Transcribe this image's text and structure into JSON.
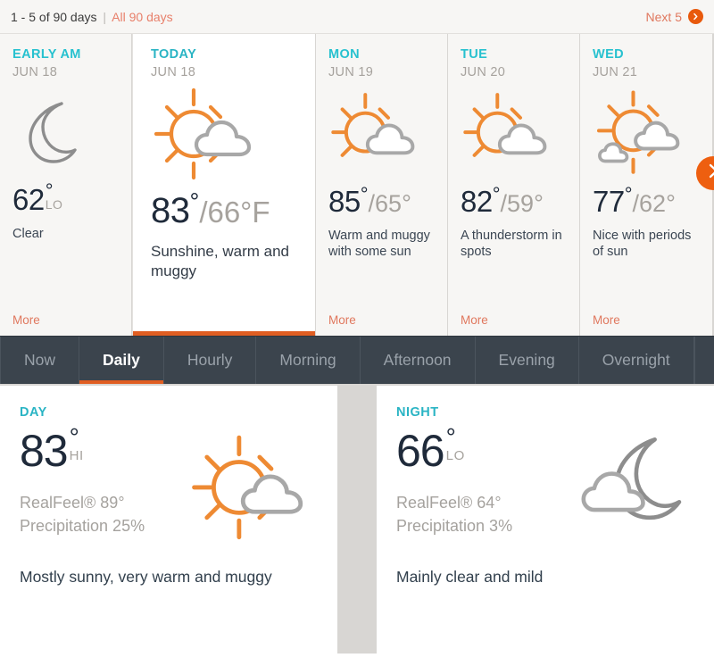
{
  "pager": {
    "range_text": "1 - 5 of 90 days",
    "separator": "|",
    "all_days_label": "All 90 days",
    "next_label": "Next 5",
    "next_icon": "arrow-right-circle-icon"
  },
  "colors": {
    "accent_orange": "#e05e22",
    "link_orange": "#e0785e",
    "teal": "#2ab4c4",
    "dark_text": "#1f2a3a",
    "muted": "#a6a29d",
    "tabbar_bg": "#3b444d",
    "strip_bg": "#d8d6d3"
  },
  "forecast_cards": [
    {
      "day": "EARLY AM",
      "date": "JUN 18",
      "icon": "moon-icon",
      "temp_main": "62",
      "degree": "°",
      "temp_label": "LO",
      "temp_secondary": "",
      "phrase": "Clear",
      "more_label": "More",
      "active": false
    },
    {
      "day": "TODAY",
      "date": "JUN 18",
      "icon": "sun-cloud-icon",
      "temp_main": "83",
      "degree": "°",
      "temp_label": "",
      "temp_secondary": "/66°F",
      "phrase": "Sunshine, warm and muggy",
      "more_label": "",
      "active": true
    },
    {
      "day": "MON",
      "date": "JUN 19",
      "icon": "sun-cloud-icon",
      "temp_main": "85",
      "degree": "°",
      "temp_label": "",
      "temp_secondary": "/65°",
      "phrase": "Warm and muggy with some sun",
      "more_label": "More",
      "active": false
    },
    {
      "day": "TUE",
      "date": "JUN 20",
      "icon": "sun-cloud-icon",
      "temp_main": "82",
      "degree": "°",
      "temp_label": "",
      "temp_secondary": "/59°",
      "phrase": "A thunderstorm in spots",
      "more_label": "More",
      "active": false
    },
    {
      "day": "WED",
      "date": "JUN 21",
      "icon": "sun-two-clouds-icon",
      "temp_main": "77",
      "degree": "°",
      "temp_label": "",
      "temp_secondary": "/62°",
      "phrase": "Nice with periods of sun",
      "more_label": "More",
      "active": false
    }
  ],
  "next_button": {
    "icon": "chevron-right-icon"
  },
  "tabs": [
    {
      "label": "Now",
      "active": false
    },
    {
      "label": "Daily",
      "active": true
    },
    {
      "label": "Hourly",
      "active": false
    },
    {
      "label": "Morning",
      "active": false
    },
    {
      "label": "Afternoon",
      "active": false
    },
    {
      "label": "Evening",
      "active": false
    },
    {
      "label": "Overnight",
      "active": false
    }
  ],
  "detail": {
    "day": {
      "label": "DAY",
      "temp": "83",
      "degree": "°",
      "temp_suffix": "HI",
      "realfeel": "RealFeel® 89°",
      "precipitation": "Precipitation 25%",
      "phrase": "Mostly sunny, very warm and muggy",
      "icon": "sun-cloud-icon"
    },
    "night": {
      "label": "NIGHT",
      "temp": "66",
      "degree": "°",
      "temp_suffix": "LO",
      "realfeel": "RealFeel® 64°",
      "precipitation": "Precipitation 3%",
      "phrase": "Mainly clear and mild",
      "icon": "moon-cloud-icon"
    }
  }
}
